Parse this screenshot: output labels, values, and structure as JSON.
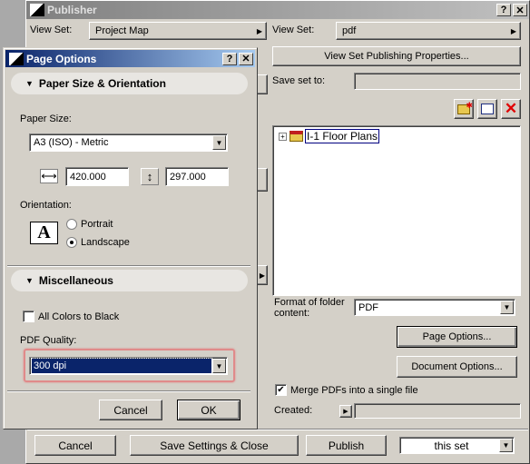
{
  "publisher": {
    "title": "Publisher",
    "left": {
      "view_set_label": "View Set:",
      "view_set_value": "Project Map"
    },
    "right": {
      "view_set_label": "View Set:",
      "view_set_value": "pdf",
      "properties_button": "View Set Publishing Properties...",
      "save_set_label": "Save set to:",
      "save_set_value": "",
      "tree": [
        {
          "label": "I-1 Floor Plans",
          "expanded": false,
          "selected": true
        }
      ],
      "format_label": "Format of folder content:",
      "format_value": "PDF",
      "page_options_button": "Page Options...",
      "document_options_button": "Document Options...",
      "merge_label": "Merge PDFs into a single file",
      "merge_checked": true,
      "created_label": "Created:",
      "created_value": ""
    },
    "footer": {
      "cancel": "Cancel",
      "save_close": "Save Settings & Close",
      "publish": "Publish",
      "scope_value": "this set"
    },
    "icons": [
      "new-folder-icon",
      "clone-folder-icon",
      "delete-icon"
    ]
  },
  "page_options": {
    "title": "Page Options",
    "paper_section": "Paper Size & Orientation",
    "paper_size_label": "Paper Size:",
    "paper_size_value": "A3 (ISO) - Metric",
    "width_value": "420.000",
    "height_value": "297.000",
    "orientation_label": "Orientation:",
    "orientation_icon_letter": "A",
    "portrait": "Portrait",
    "landscape": "Landscape",
    "orientation_selected": "Landscape",
    "misc_section": "Miscellaneous",
    "all_black_label": "All Colors to Black",
    "all_black_checked": false,
    "pdf_quality_label": "PDF Quality:",
    "pdf_quality_value": "300 dpi",
    "cancel": "Cancel",
    "ok": "OK",
    "highlight_color": "#e08a8a",
    "title_gradient": [
      "#0a246a",
      "#a6caf0"
    ]
  }
}
